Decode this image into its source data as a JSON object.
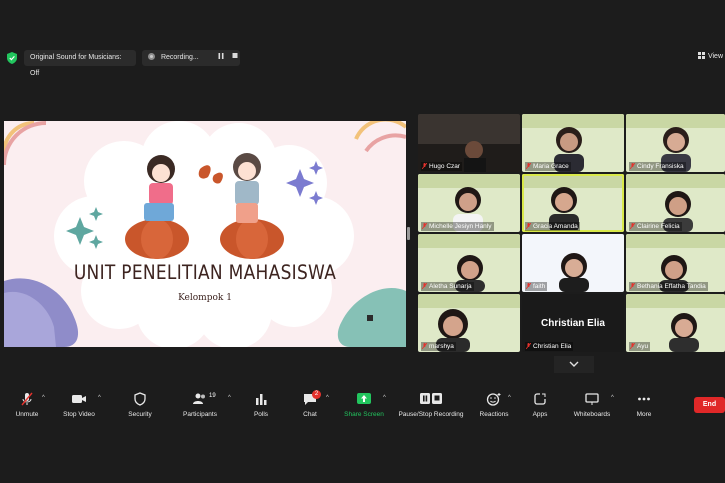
{
  "topbar": {
    "sound_label": "Original Sound for Musicians: Off",
    "recording_label": "Recording...",
    "view_label": "View"
  },
  "slide": {
    "title": "UNIT PENELITIAN MAHASISWA",
    "subtitle": "Kelompok 1"
  },
  "participants": [
    {
      "name": "Hugo Czar"
    },
    {
      "name": "Maria Grace"
    },
    {
      "name": "Cindy Fransiska"
    },
    {
      "name": "Michelle Jesiyn Hanly"
    },
    {
      "name": "Gracia Amanda"
    },
    {
      "name": "Clairine Felicia"
    },
    {
      "name": "Aletha Sunarja"
    },
    {
      "name": "faith"
    },
    {
      "name": "Bethania Effatha Tandia"
    },
    {
      "name": "marshya"
    },
    {
      "name": "Christian Elia",
      "placeholder_name": "Christian Elia"
    },
    {
      "name": "Ayu"
    }
  ],
  "toolbar": {
    "unmute": "Unmute",
    "stop_video": "Stop Video",
    "security": "Security",
    "participants": "Participants",
    "participants_count": "19",
    "polls": "Polls",
    "chat": "Chat",
    "chat_badge": "2",
    "share_screen": "Share Screen",
    "pause_recording": "Pause/Stop Recording",
    "reactions": "Reactions",
    "apps": "Apps",
    "whiteboards": "Whiteboards",
    "more": "More",
    "end": "End"
  },
  "colors": {
    "background": "#1c1c1c",
    "share_green": "#22c55e",
    "end_red": "#e02828",
    "active_speaker": "#d9e94a",
    "slide_bg": "#fbeef0"
  }
}
